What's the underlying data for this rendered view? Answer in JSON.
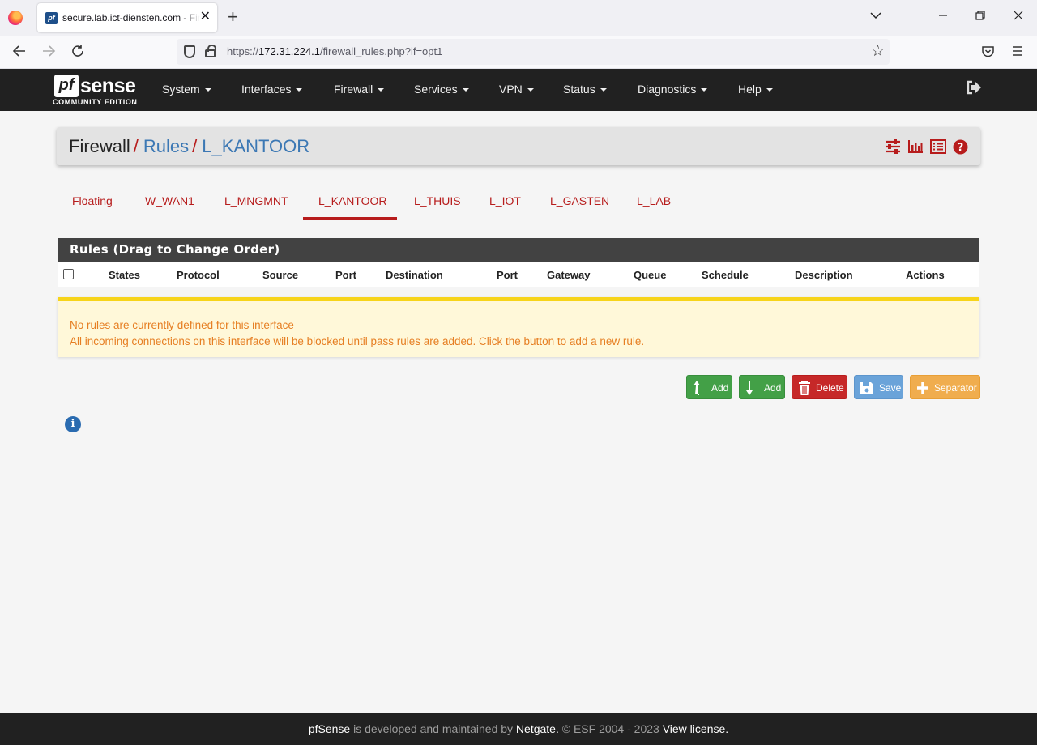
{
  "browser": {
    "tab_title": "secure.lab.ict-diensten.com - Firewall: Rules: L_KANTOOR",
    "tab_favicon": "pf",
    "url_scheme": "https://",
    "url_host": "172.31.224.1",
    "url_path": "/firewall_rules.php?if=opt1"
  },
  "header": {
    "logo_mark": "pf",
    "logo_word": "sense",
    "logo_sub": "COMMUNITY EDITION",
    "menu": [
      "System",
      "Interfaces",
      "Firewall",
      "Services",
      "VPN",
      "Status",
      "Diagnostics",
      "Help"
    ]
  },
  "breadcrumb": {
    "section": "Firewall",
    "sep": "/",
    "page": "Rules",
    "interface": "L_KANTOOR"
  },
  "tabs": {
    "items": [
      "Floating",
      "W_WAN1",
      "L_MNGMNT",
      "L_KANTOOR",
      "L_THUIS",
      "L_IOT",
      "L_GASTEN",
      "L_LAB"
    ],
    "active": "L_KANTOOR"
  },
  "rules_panel": {
    "title": "Rules (Drag to Change Order)",
    "columns": [
      "States",
      "Protocol",
      "Source",
      "Port",
      "Destination",
      "Port",
      "Gateway",
      "Queue",
      "Schedule",
      "Description",
      "Actions"
    ]
  },
  "warning": {
    "line1": "No rules are currently defined for this interface",
    "line2": "All incoming connections on this interface will be blocked until pass rules are added. Click the button to add a new rule."
  },
  "buttons": {
    "add_top": "Add",
    "add_bottom": "Add",
    "delete": "Delete",
    "save": "Save",
    "separator": "Separator"
  },
  "footer": {
    "brand": "pfSense",
    "text1": " is developed and maintained by ",
    "company": "Netgate.",
    "text2": " © ESF 2004 - 2023 ",
    "license": "View license."
  },
  "colors": {
    "accent_red": "#b71c1c",
    "header_bg": "#212121",
    "link_blue": "#3c78b4",
    "warning_text": "#e67e22",
    "warning_border": "#f7d41a",
    "success_green": "#43a047"
  }
}
